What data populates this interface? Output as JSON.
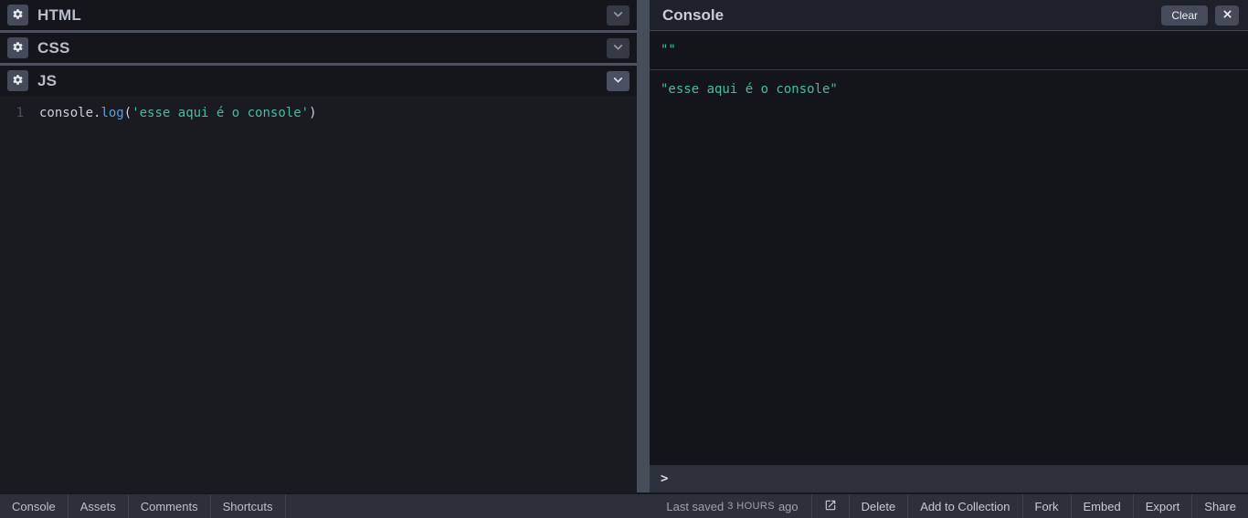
{
  "editors": {
    "panels": [
      {
        "title": "HTML"
      },
      {
        "title": "CSS"
      },
      {
        "title": "JS"
      }
    ],
    "js_code": {
      "line_number": "1",
      "tokens": {
        "object": "console",
        "dot": ".",
        "method": "log",
        "open_paren": "(",
        "string": "'esse aqui é o console'",
        "close_paren": ")"
      }
    }
  },
  "console_panel": {
    "title": "Console",
    "clear_button": "Clear",
    "entries": [
      "\"\"",
      "\"esse aqui é o console\""
    ],
    "prompt_caret": ">"
  },
  "footer": {
    "tabs": [
      "Console",
      "Assets",
      "Comments",
      "Shortcuts"
    ],
    "last_saved_prefix": "Last saved",
    "last_saved_time": "3 hours",
    "last_saved_suffix": "ago",
    "actions": [
      "Delete",
      "Add to Collection",
      "Fork",
      "Embed",
      "Export",
      "Share"
    ]
  },
  "icons": {
    "gear": "gear-icon",
    "chevron": "chevron-down-icon",
    "close": "close-icon",
    "open_live_view": "open-in-new-icon"
  },
  "colors": {
    "string_teal": "#46bda2",
    "method_blue": "#5c9edd",
    "panel_divider": "#4b5160",
    "button_bg": "#464b59",
    "footer_bg": "#2b303a",
    "console_bg": "#14151a"
  }
}
